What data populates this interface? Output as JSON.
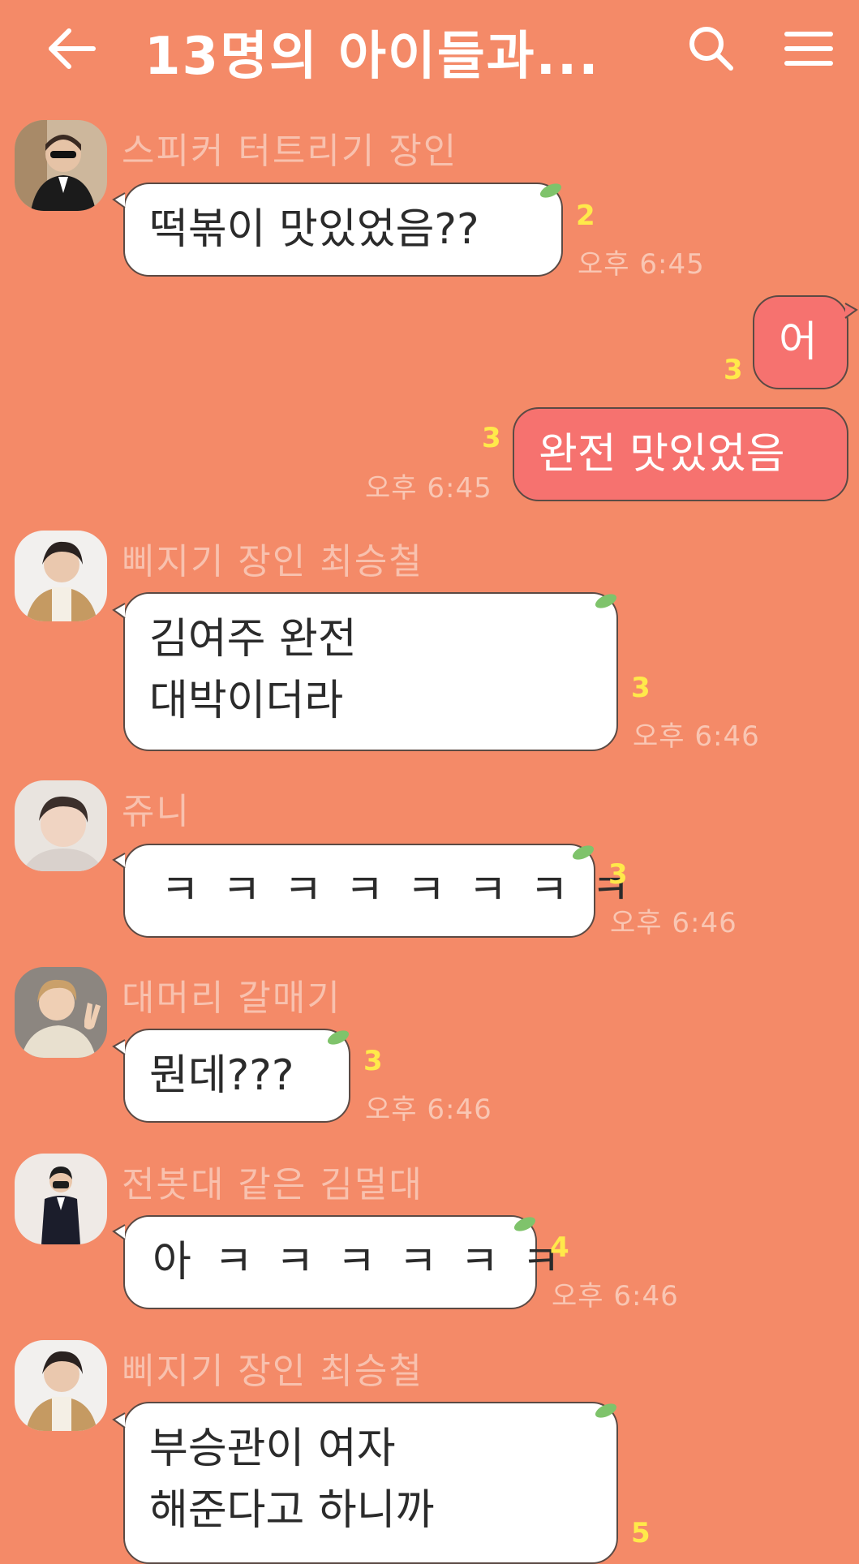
{
  "header": {
    "title": "13명의 아이들과...",
    "back_icon": "arrow-left-icon",
    "search_icon": "search-icon",
    "menu_icon": "hamburger-menu-icon"
  },
  "colors": {
    "background": "#f48a68",
    "my_bubble": "#f6726f",
    "other_bubble": "#ffffff",
    "unread": "#ffe94a",
    "sender_name": "#f8c1ae"
  },
  "messages": [
    {
      "sender": "스피커 터트리기 장인",
      "lines": [
        "떡볶이 맛있었음??"
      ],
      "unread": "2",
      "time": "오후 6:45"
    },
    {
      "mine": true,
      "lines": [
        "어"
      ],
      "unread": "3"
    },
    {
      "mine": true,
      "lines": [
        "완전 맛있었음"
      ],
      "unread": "3",
      "time": "오후 6:45"
    },
    {
      "sender": "삐지기 장인 최승철",
      "lines": [
        "김여주 완전",
        "대박이더라"
      ],
      "unread": "3",
      "time": "오후 6:46"
    },
    {
      "sender": "쥬니",
      "lines": [
        "ㅋㅋㅋㅋㅋㅋㅋㅋ"
      ],
      "unread": "3",
      "time": "오후 6:46"
    },
    {
      "sender": "대머리 갈매기",
      "lines": [
        "뭔데???"
      ],
      "unread": "3",
      "time": "오후 6:46"
    },
    {
      "sender": "전봇대 같은 김멀대",
      "lines": [
        "아ㅋㅋㅋㅋㅋㅋ"
      ],
      "unread": "4",
      "time": "오후 6:46"
    },
    {
      "sender": "삐지기 장인 최승철",
      "lines": [
        "부승관이 여자",
        "해준다고 하니까"
      ],
      "unread": "5"
    }
  ]
}
